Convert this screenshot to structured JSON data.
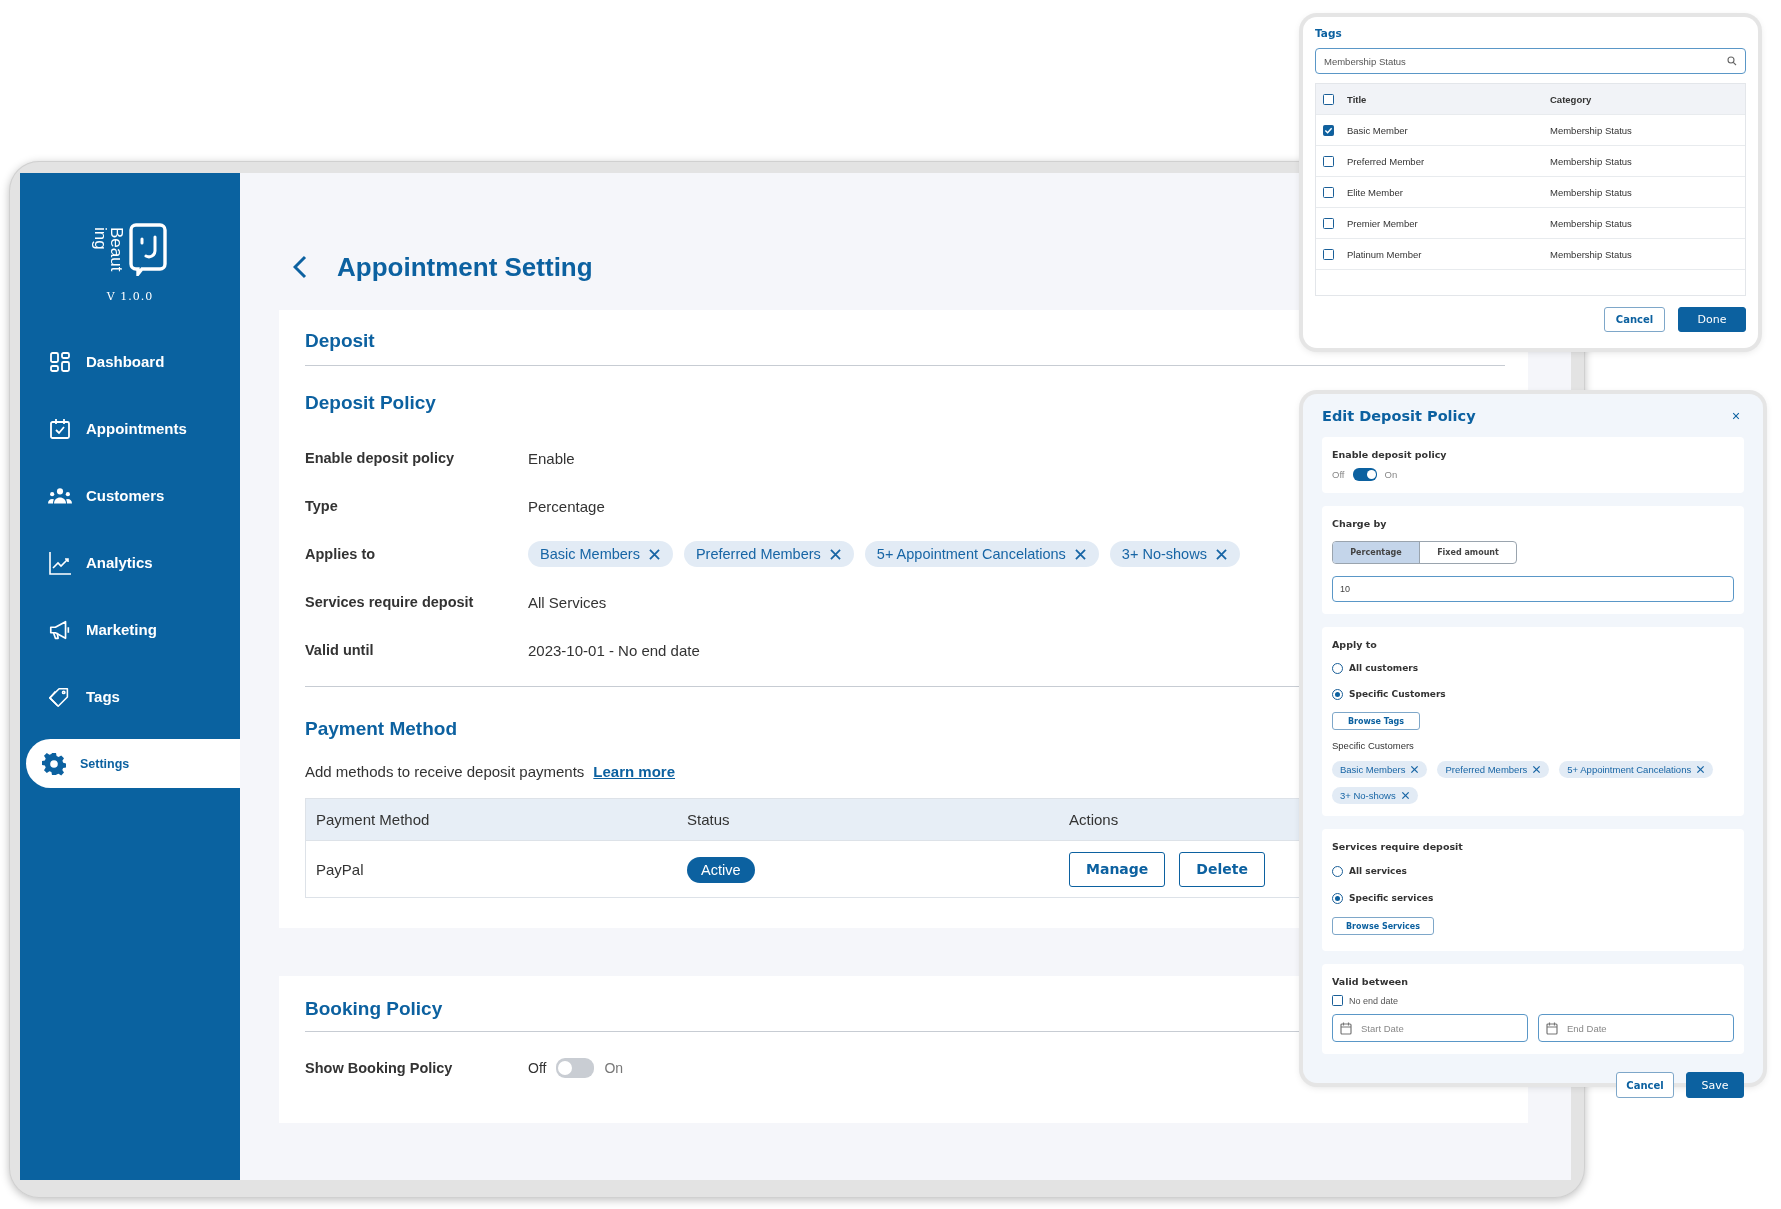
{
  "sidebar": {
    "logo_text": [
      "Beaut",
      "ing"
    ],
    "version": "V 1.0.0",
    "items": [
      {
        "label": "Dashboard",
        "selected": false
      },
      {
        "label": "Appointments",
        "selected": false
      },
      {
        "label": "Customers",
        "selected": false
      },
      {
        "label": "Analytics",
        "selected": false
      },
      {
        "label": "Marketing",
        "selected": false
      },
      {
        "label": "Tags",
        "selected": false
      },
      {
        "label": "Settings",
        "selected": true
      }
    ]
  },
  "page": {
    "title": "Appointment Setting"
  },
  "deposit": {
    "heading": "Deposit",
    "policy_heading": "Deposit Policy",
    "fields": [
      {
        "kind": "text",
        "label": "Enable deposit policy",
        "value": "Enable"
      },
      {
        "kind": "text",
        "label": "Type",
        "value": "Percentage"
      },
      {
        "kind": "tags",
        "label": "Applies to",
        "tags": [
          "Basic Members",
          "Preferred Members",
          "5+ Appointment Cancelations",
          "3+ No-shows"
        ]
      },
      {
        "kind": "text",
        "label": "Services require deposit",
        "value": "All Services"
      },
      {
        "kind": "text",
        "label": "Valid until",
        "value": "2023-10-01 - No end date"
      }
    ]
  },
  "payment": {
    "heading": "Payment Method",
    "description": "Add methods to receive deposit payments",
    "link": "Learn more",
    "table": {
      "columns": [
        "Payment Method",
        "Status",
        "Actions"
      ],
      "rows": [
        {
          "method": "PayPal",
          "status": "Active",
          "actions": [
            "Manage",
            "Delete"
          ]
        }
      ]
    }
  },
  "booking": {
    "heading": "Booking Policy",
    "label": "Show Booking Policy",
    "off_label": "Off",
    "on_label": "On",
    "on": false
  },
  "tags_dialog": {
    "title": "Tags",
    "search": "Membership Status",
    "all_checked": false,
    "columns": [
      "Title",
      "Category"
    ],
    "rows": [
      {
        "title": "Basic Member",
        "category": "Membership Status",
        "checked": true
      },
      {
        "title": "Preferred Member",
        "category": "Membership Status",
        "checked": false
      },
      {
        "title": "Elite Member",
        "category": "Membership Status",
        "checked": false
      },
      {
        "title": "Premier Member",
        "category": "Membership Status",
        "checked": false
      },
      {
        "title": "Platinum Member",
        "category": "Membership Status",
        "checked": false
      }
    ],
    "buttons": [
      {
        "label": "Cancel",
        "kind": "secondary"
      },
      {
        "label": "Done",
        "kind": "primary"
      }
    ]
  },
  "edit_dialog": {
    "title": "Edit Deposit Policy",
    "enable": {
      "label": "Enable deposit policy",
      "off_label": "Off",
      "on_label": "On",
      "on": true
    },
    "charge_by": {
      "label": "Charge by",
      "options": [
        {
          "label": "Percentage",
          "selected": true
        },
        {
          "label": "Fixed amount",
          "selected": false
        }
      ],
      "value": "10"
    },
    "apply_to": {
      "label": "Apply to",
      "options": [
        {
          "label": "All customers",
          "selected": false
        },
        {
          "label": "Specific Customers",
          "selected": true
        }
      ],
      "browse_button": "Browse Tags",
      "chips_label": "Specific Customers",
      "chips": [
        "Basic Members",
        "Preferred Members",
        "5+ Appointment Cancelations",
        "3+ No-shows"
      ]
    },
    "services": {
      "label": "Services require deposit",
      "options": [
        {
          "label": "All services",
          "selected": false
        },
        {
          "label": "Specific services",
          "selected": true
        }
      ],
      "browse_button": "Browse Services"
    },
    "valid_between": {
      "label": "Valid between",
      "no_end_date": {
        "label": "No end date",
        "checked": false
      },
      "start_placeholder": "Start Date",
      "end_placeholder": "End Date"
    },
    "buttons": [
      {
        "label": "Cancel",
        "kind": "secondary"
      },
      {
        "label": "Save",
        "kind": "primary"
      }
    ]
  }
}
